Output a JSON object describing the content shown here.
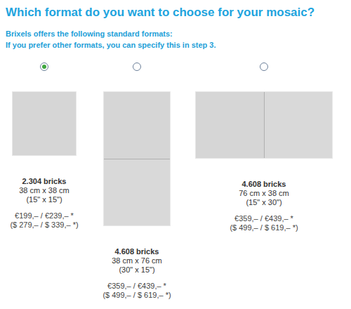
{
  "title": "Which format do you want to choose for your mosaic?",
  "subtitle": [
    "Brixels offers the following standard formats:",
    "If you prefer other formats, you can specify this in step 3."
  ],
  "formats": [
    {
      "selected": true,
      "kind": "square",
      "bricks": "2.304 bricks",
      "size": "38 cm x 38 cm",
      "inches": "(15\" x 15\")",
      "price_eur": "€199,– / €239,– *",
      "price_usd": "($ 279,– / $ 339,– *)"
    },
    {
      "selected": false,
      "kind": "tall",
      "bricks": "4.608 bricks",
      "size": "38 cm x 76 cm",
      "inches": "(30\" x 15\")",
      "price_eur": "€359,– / €439,– *",
      "price_usd": "($ 499,– / $ 619,– *)"
    },
    {
      "selected": false,
      "kind": "wide",
      "bricks": "4.608 bricks",
      "size": "76 cm x 38 cm",
      "inches": "(15\" x 30\")",
      "price_eur": "€359,– / €439,– *",
      "price_usd": "($ 499,– / $ 619,– *)"
    }
  ]
}
